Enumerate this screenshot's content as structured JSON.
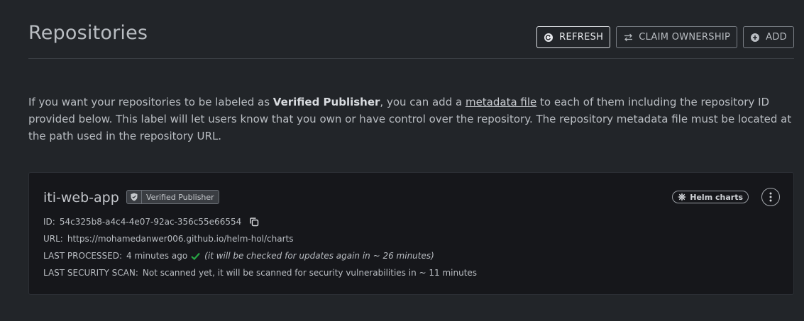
{
  "header": {
    "title": "Repositories",
    "buttons": {
      "refresh": "REFRESH",
      "claim": "CLAIM OWNERSHIP",
      "add": "ADD"
    }
  },
  "intro": {
    "part1": "If you want your repositories to be labeled as ",
    "bold": "Verified Publisher",
    "part2": ", you can add a ",
    "link": "metadata file",
    "part3": " to each of them including the repository ID provided below. This label will let users know that you own or have control over the repository. The repository metadata file must be located at the path used in the repository URL."
  },
  "repo": {
    "name": "iti-web-app",
    "verified_label": "Verified Publisher",
    "kind": "Helm charts",
    "id_label": "ID:",
    "id_value": "54c325b8-a4c4-4e07-92ac-356c55e66554",
    "url_label": "URL:",
    "url_value": "https://mohamedanwer006.github.io/helm-hol/charts",
    "processed_label": "LAST PROCESSED:",
    "processed_value": "4 minutes ago",
    "processed_note": "(it will be checked for updates again in ~ 26 minutes)",
    "scan_label": "LAST SECURITY SCAN:",
    "scan_value": "Not scanned yet, it will be scanned for security vulnerabilities in ~ 11 minutes"
  },
  "icons": {
    "refresh": "refresh-icon",
    "claim": "swap-arrows-icon",
    "add": "plus-circle-icon",
    "verified": "shield-check-icon",
    "kind": "helm-wheel-icon",
    "menu": "kebab-menu-icon",
    "copy": "copy-icon",
    "check": "check-icon"
  },
  "colors": {
    "background": "#222529",
    "card": "#16171b",
    "success": "#28a745"
  }
}
